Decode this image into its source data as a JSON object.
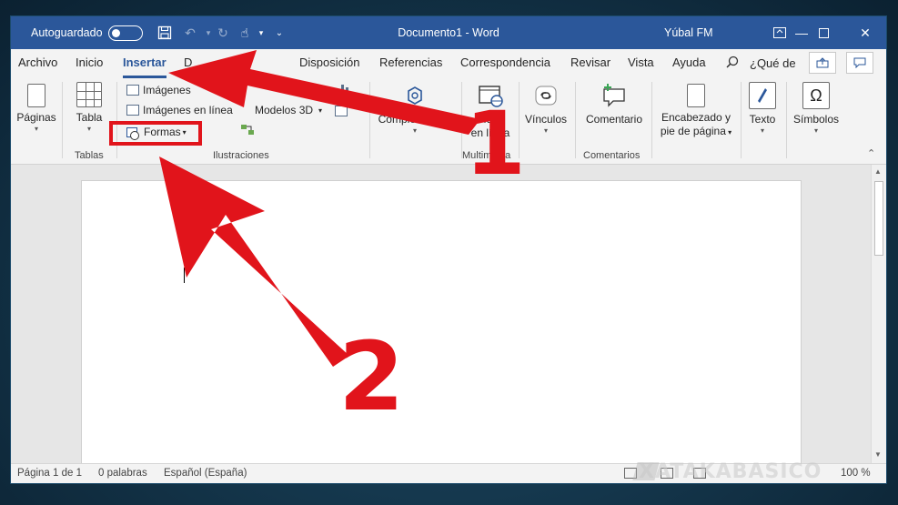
{
  "titlebar": {
    "autosave_label": "Autoguardado",
    "document_title": "Documento1  -  Word",
    "user_name": "Yúbal FM"
  },
  "tabs": [
    {
      "label": "Archivo"
    },
    {
      "label": "Inicio"
    },
    {
      "label": "Insertar",
      "active": true
    },
    {
      "label": "Disposición"
    },
    {
      "label": "Referencias"
    },
    {
      "label": "Correspondencia"
    },
    {
      "label": "Revisar"
    },
    {
      "label": "Vista"
    },
    {
      "label": "Ayuda"
    }
  ],
  "help_search": "¿Qué de",
  "ribbon": {
    "paginas": "Páginas",
    "tabla": "Tabla",
    "imagenes": "Imágenes",
    "imagenes_linea": "Imágenes en línea",
    "formas": "Formas",
    "modelos3d": "Modelos 3D",
    "complementos": "Complementos",
    "video_line1": "Vídeo",
    "video_line2": "en línea",
    "vinculos": "Vínculos",
    "comentario": "Comentario",
    "encabezado_line1": "Encabezado y",
    "encabezado_line2": "pie de página",
    "texto": "Texto",
    "simbolos": "Símbolos",
    "groups": {
      "tablas": "Tablas",
      "ilustraciones": "Ilustraciones",
      "multimedia": "Multimedia",
      "comentarios": "Comentarios"
    }
  },
  "statusbar": {
    "page": "Página 1 de 1",
    "words": "0 palabras",
    "language": "Español (España)",
    "zoom": "100 %"
  },
  "watermark": "XATAKABASICO",
  "annotations": {
    "one": "1",
    "two": "2"
  },
  "colors": {
    "brand": "#2b579a",
    "annotation": "#e1141b"
  }
}
